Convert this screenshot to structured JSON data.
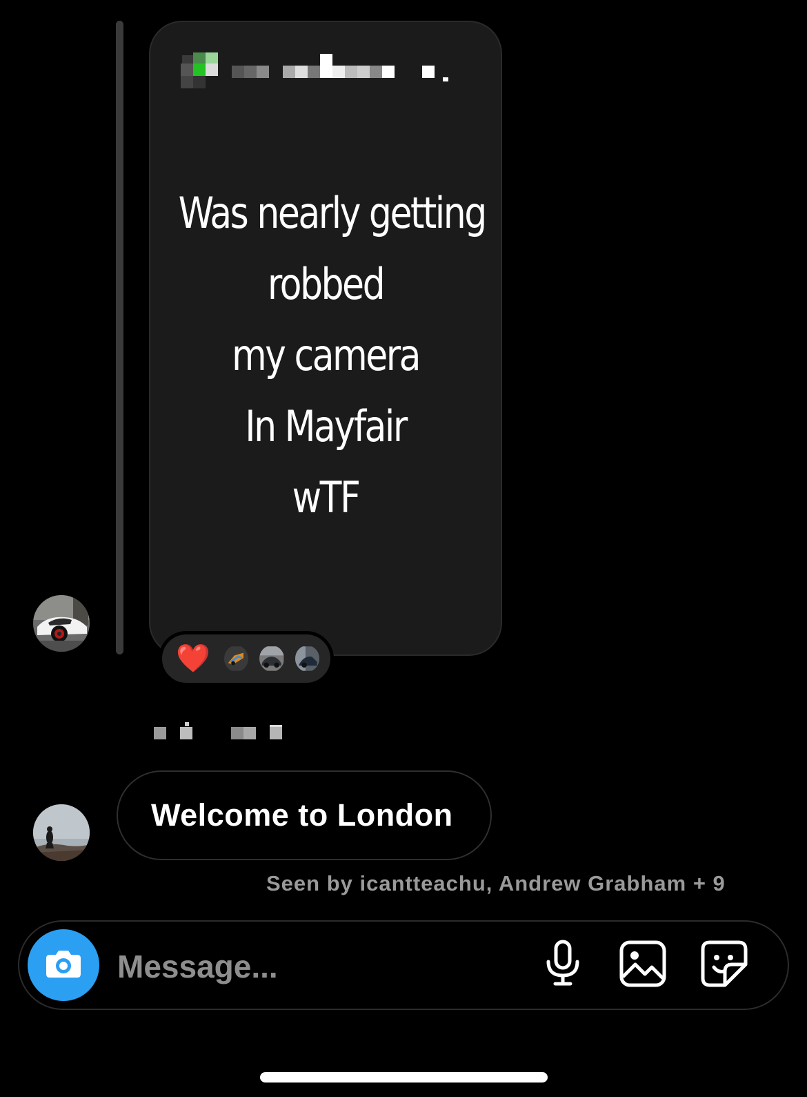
{
  "story": {
    "lines": [
      "Was nearly getting",
      "robbed",
      "my camera",
      "In Mayfair",
      "wTF"
    ]
  },
  "reactions": {
    "emoji": "❤️",
    "reactor_avatars": [
      "car-avatar",
      "car-avatar",
      "car-avatar"
    ]
  },
  "message": {
    "text": "Welcome to London"
  },
  "seen": {
    "text": "Seen by icantteachu, Andrew Grabham + 9"
  },
  "composer": {
    "placeholder": "Message...",
    "icons": [
      "camera-icon",
      "microphone-icon",
      "gallery-icon",
      "sticker-icon"
    ],
    "camera_color": "#2b9ff2"
  }
}
